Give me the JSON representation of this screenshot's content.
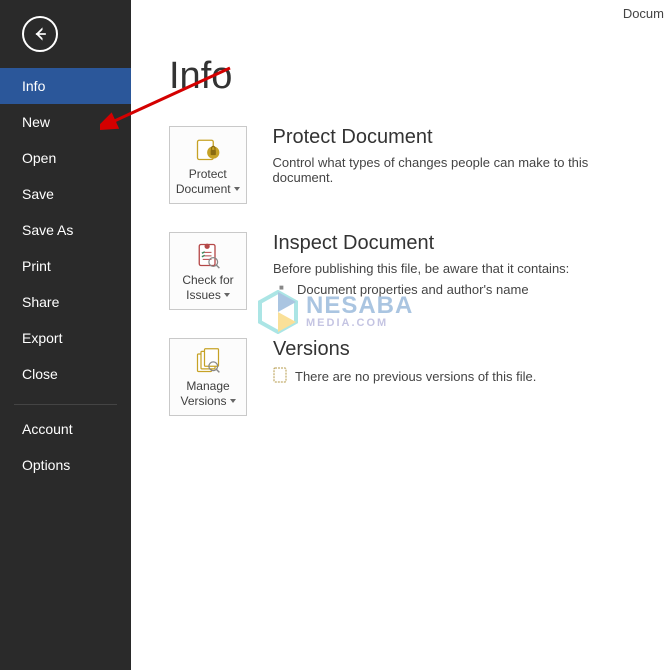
{
  "top_title": "Docum",
  "page_title": "Info",
  "sidebar": {
    "items": [
      {
        "label": "Info"
      },
      {
        "label": "New"
      },
      {
        "label": "Open"
      },
      {
        "label": "Save"
      },
      {
        "label": "Save As"
      },
      {
        "label": "Print"
      },
      {
        "label": "Share"
      },
      {
        "label": "Export"
      },
      {
        "label": "Close"
      }
    ],
    "active_index": 0,
    "lower_items": [
      {
        "label": "Account"
      },
      {
        "label": "Options"
      }
    ]
  },
  "sections": {
    "protect": {
      "heading": "Protect Document",
      "text": "Control what types of changes people can make to this document.",
      "tile_line1": "Protect",
      "tile_line2": "Document"
    },
    "inspect": {
      "heading": "Inspect Document",
      "text": "Before publishing this file, be aware that it contains:",
      "bullet1": "Document properties and author's name",
      "tile_line1": "Check for",
      "tile_line2": "Issues"
    },
    "versions": {
      "heading": "Versions",
      "text": "There are no previous versions of this file.",
      "tile_line1": "Manage",
      "tile_line2": "Versions"
    }
  },
  "watermark": {
    "brand": "NESABA",
    "sub": "MEDIA.COM"
  }
}
